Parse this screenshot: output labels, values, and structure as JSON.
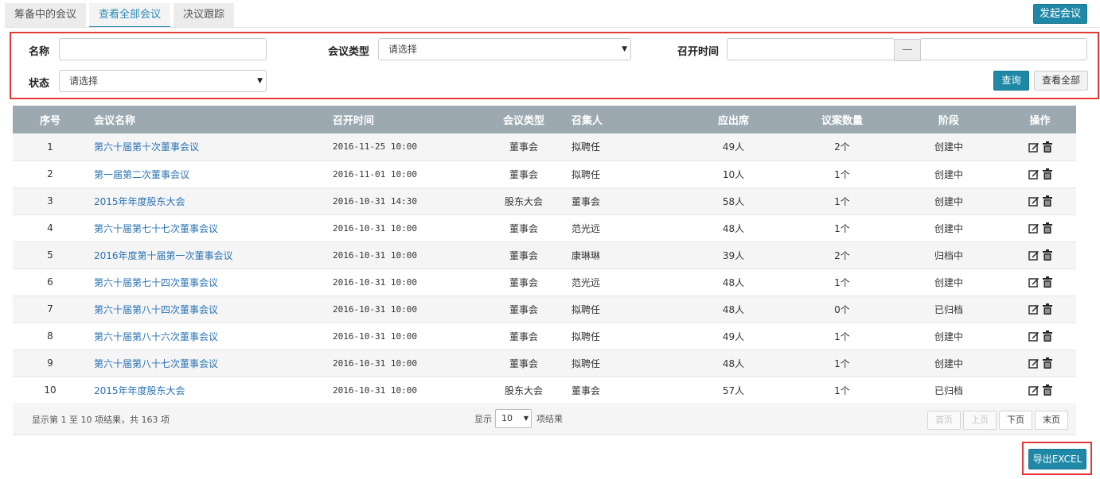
{
  "tabs": [
    "筹备中的会议",
    "查看全部会议",
    "决议跟踪"
  ],
  "active_tab": 1,
  "launch_button": "发起会议",
  "filter": {
    "name_label": "名称",
    "type_label": "会议类型",
    "type_placeholder": "请选择",
    "time_label": "召开时间",
    "time_sep": "—",
    "status_label": "状态",
    "status_placeholder": "请选择",
    "query_button": "查询",
    "viewall_button": "查看全部"
  },
  "table": {
    "headers": [
      "序号",
      "会议名称",
      "召开时间",
      "会议类型",
      "召集人",
      "应出席",
      "议案数量",
      "阶段",
      "操作"
    ],
    "rows": [
      [
        "1",
        "第六十届第十次董事会议",
        "2016-11-25 10:00",
        "董事会",
        "拟聘任",
        "49人",
        "2个",
        "创建中"
      ],
      [
        "2",
        "第一届第二次董事会议",
        "2016-11-01 10:00",
        "董事会",
        "拟聘任",
        "10人",
        "1个",
        "创建中"
      ],
      [
        "3",
        "2015年年度股东大会",
        "2016-10-31 14:30",
        "股东大会",
        "董事会",
        "58人",
        "1个",
        "创建中"
      ],
      [
        "4",
        "第六十届第七十七次董事会议",
        "2016-10-31 10:00",
        "董事会",
        "范光远",
        "48人",
        "1个",
        "创建中"
      ],
      [
        "5",
        "2016年度第十届第一次董事会议",
        "2016-10-31 10:00",
        "董事会",
        "康琳琳",
        "39人",
        "2个",
        "归档中"
      ],
      [
        "6",
        "第六十届第七十四次董事会议",
        "2016-10-31 10:00",
        "董事会",
        "范光远",
        "48人",
        "1个",
        "创建中"
      ],
      [
        "7",
        "第六十届第八十四次董事会议",
        "2016-10-31 10:00",
        "董事会",
        "拟聘任",
        "48人",
        "0个",
        "已归档"
      ],
      [
        "8",
        "第六十届第八十六次董事会议",
        "2016-10-31 10:00",
        "董事会",
        "拟聘任",
        "49人",
        "1个",
        "创建中"
      ],
      [
        "9",
        "第六十届第八十七次董事会议",
        "2016-10-31 10:00",
        "董事会",
        "拟聘任",
        "48人",
        "1个",
        "创建中"
      ],
      [
        "10",
        "2015年年度股东大会",
        "2016-10-31 10:00",
        "股东大会",
        "董事会",
        "57人",
        "1个",
        "已归档"
      ]
    ],
    "row_icons": [
      "edit-icon",
      "delete-icon"
    ]
  },
  "footer": {
    "info": "显示第 1 至 10 项结果，共 163 项",
    "show_label": "显示",
    "page_length": "10",
    "result_label": "项结果",
    "first": "首页",
    "prev": "上页",
    "next": "下页",
    "last": "末页"
  },
  "export_button": "导出EXCEL",
  "colors": {
    "accent": "#1f88a7",
    "link": "#2a73b3",
    "header_bg": "#9ca9b1",
    "highlight": "#e53935"
  }
}
